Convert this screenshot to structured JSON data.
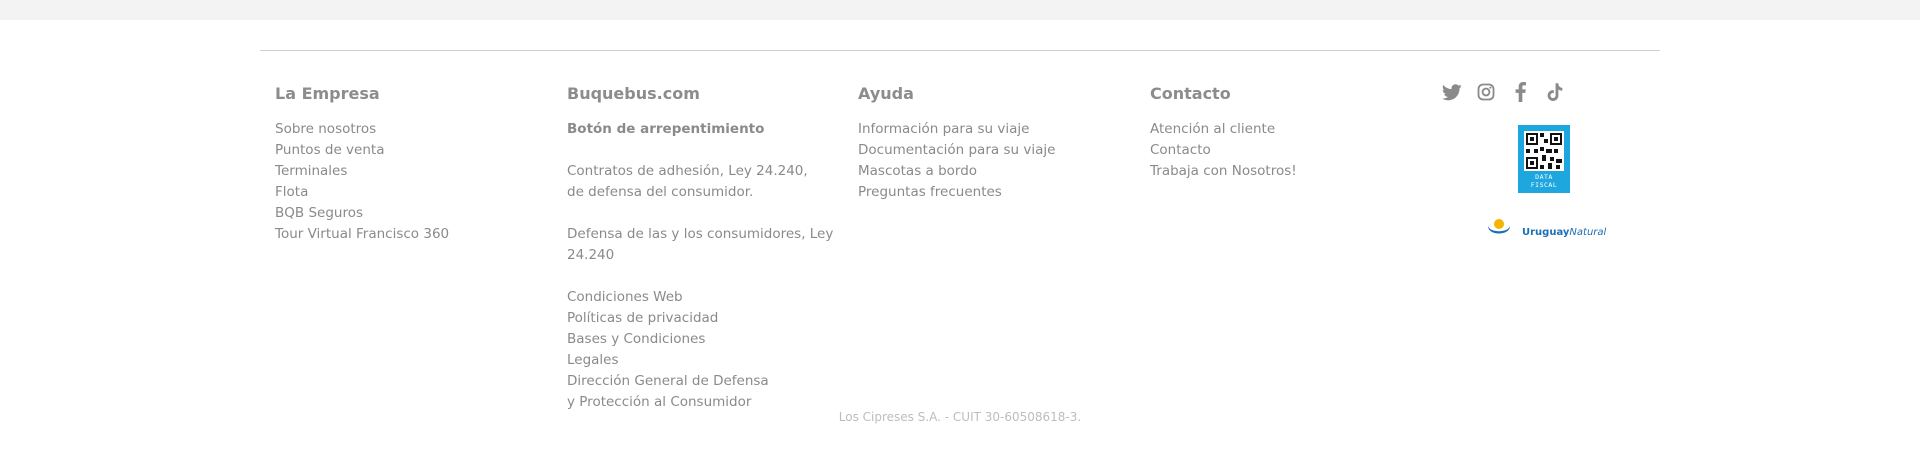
{
  "footer": {
    "columns": [
      {
        "title": "La Empresa",
        "links": [
          "Sobre nosotros",
          "Puntos de venta",
          "Terminales",
          "Flota",
          "BQB Seguros",
          "Tour Virtual Francisco 360"
        ]
      },
      {
        "title": "Buquebus.com",
        "links": [
          "Botón de arrepentimiento",
          "Contratos de adhesión, Ley 24.240,",
          "de defensa del consumidor.",
          "Defensa de las y los consumidores, Ley 24.240",
          "Condiciones Web",
          "Políticas de privacidad",
          "Bases y Condiciones",
          "Legales",
          "Dirección General de Defensa",
          "y Protección al Consumidor"
        ]
      },
      {
        "title": "Ayuda",
        "links": [
          "Información para su viaje",
          "Documentación para su viaje",
          "Mascotas a bordo",
          "Preguntas frecuentes"
        ]
      },
      {
        "title": "Contacto",
        "links": [
          "Atención al cliente",
          "Contacto",
          "Trabaja con Nosotros!"
        ]
      }
    ],
    "social": {
      "icons": [
        "twitter-icon",
        "instagram-icon",
        "facebook-icon",
        "tiktok-icon"
      ],
      "color": "#8a8a8a"
    },
    "badges": {
      "data_fiscal_label_1": "DATA",
      "data_fiscal_label_2": "FISCAL",
      "data_fiscal_color": "#1ea7df",
      "uruguay_word_1": "Uruguay",
      "uruguay_word_2": "Natural",
      "uruguay_color": "#1c6fb6"
    },
    "legal_text": "Los Cipreses S.A. - CUIT 30-60508618-3."
  }
}
